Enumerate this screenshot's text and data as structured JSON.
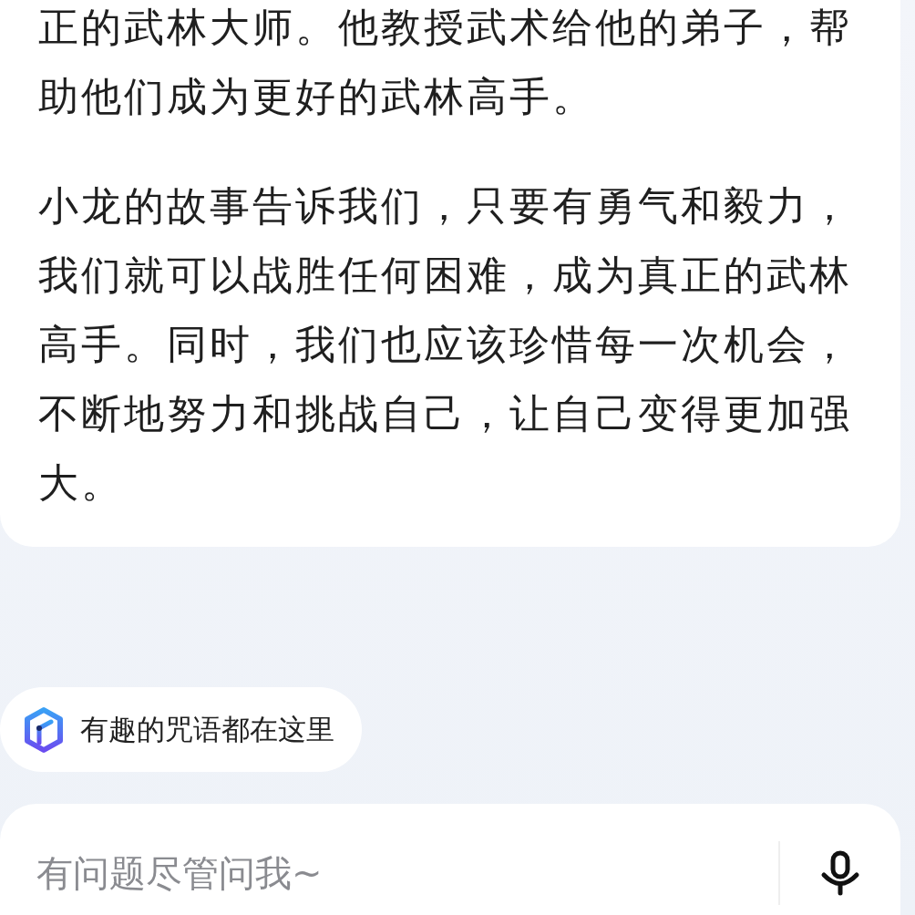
{
  "message": {
    "paragraphs": [
      "正的武林大师。他教授武术给他的弟子，帮助他们成为更好的武林高手。",
      "小龙的故事告诉我们，只要有勇气和毅力，我们就可以战胜任何困难，成为真正的武林高手。同时，我们也应该珍惜每一次机会，不断地努力和挑战自己，让自己变得更加强大。"
    ]
  },
  "suggestion": {
    "label": "有趣的咒语都在这里"
  },
  "input": {
    "placeholder": "有问题尽管问我~"
  }
}
